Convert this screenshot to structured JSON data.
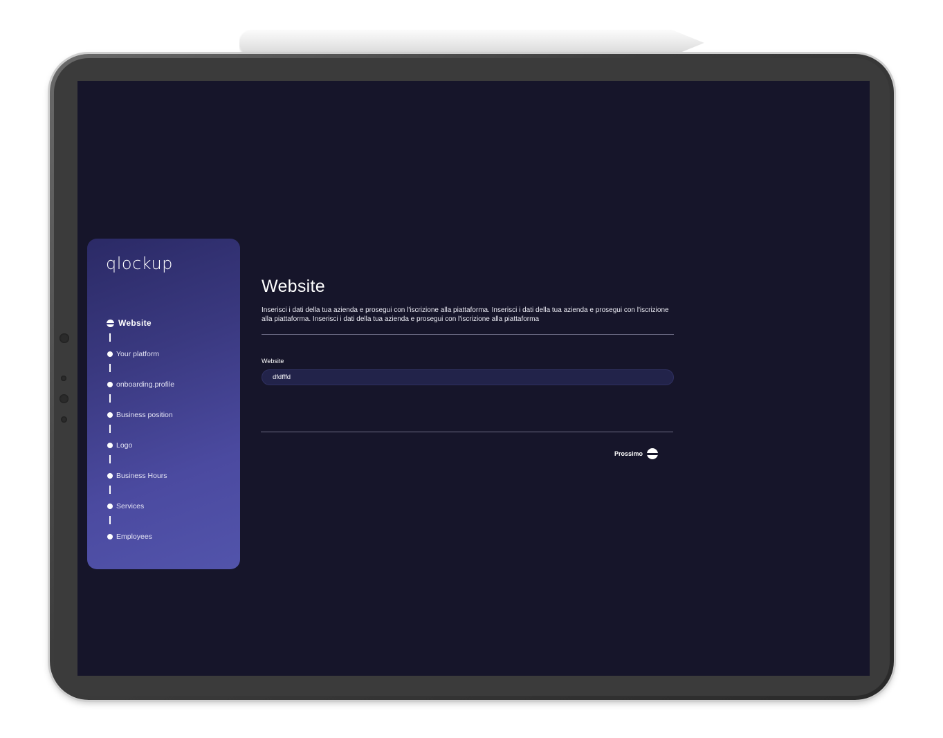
{
  "brand": {
    "logo_text": "qlockup"
  },
  "steps": [
    {
      "label": "Website",
      "active": true
    },
    {
      "label": "Your platform",
      "active": false
    },
    {
      "label": "onboarding.profile",
      "active": false
    },
    {
      "label": "Business position",
      "active": false
    },
    {
      "label": "Logo",
      "active": false
    },
    {
      "label": "Business Hours",
      "active": false
    },
    {
      "label": "Services",
      "active": false
    },
    {
      "label": "Employees",
      "active": false
    }
  ],
  "main": {
    "title": "Website",
    "description": "Inserisci i dati della tua azienda e prosegui con l'iscrizione alla piattaforma. Inserisci i dati della tua azienda e prosegui con l'iscrizione alla piattaforma. Inserisci i dati della tua azienda e prosegui con l'iscrizione alla piattaforma",
    "website_field": {
      "label": "Website",
      "value": "dfdfffd"
    },
    "next_label": "Prossimo"
  },
  "colors": {
    "screen_bg": "#16152a",
    "card_gradient_start": "#2b2a66",
    "card_gradient_end": "#5254ab",
    "input_bg": "#22234a"
  },
  "icons": {
    "step_active": "half-circle-icon",
    "step_inactive": "dot-icon",
    "next": "arrow-circle-icon"
  }
}
